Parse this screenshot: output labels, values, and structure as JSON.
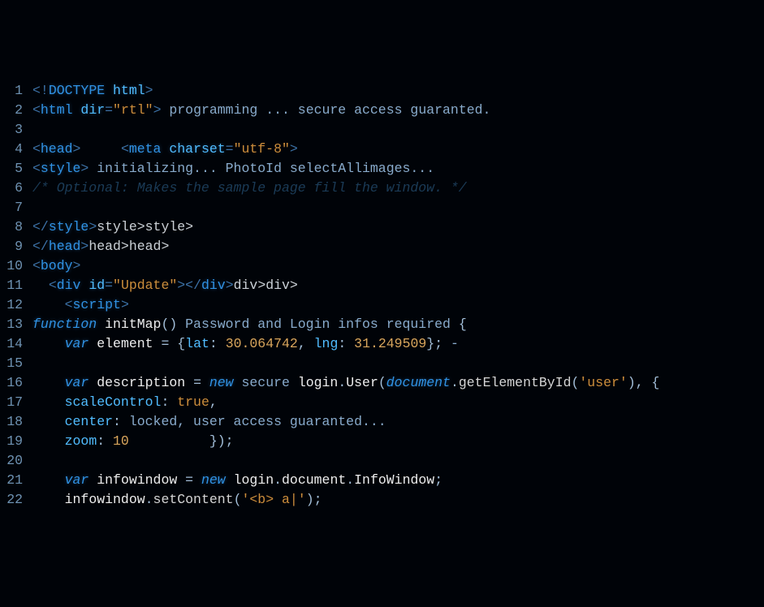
{
  "editor": {
    "lines": [
      {
        "num": "1",
        "tokens": [
          [
            "punc",
            "<"
          ],
          [
            "punc",
            "!"
          ],
          [
            "tag",
            "DOCTYPE "
          ],
          [
            "attr",
            "html"
          ],
          [
            "punc",
            ">"
          ]
        ]
      },
      {
        "num": "2",
        "tokens": [
          [
            "punc",
            "<"
          ],
          [
            "tag",
            "html "
          ],
          [
            "attr",
            "dir"
          ],
          [
            "punc",
            "="
          ],
          [
            "str",
            "\"rtl\""
          ],
          [
            "punc",
            ">"
          ],
          [
            "text",
            " programming ... secure access guaranted."
          ]
        ]
      },
      {
        "num": "3",
        "tokens": []
      },
      {
        "num": "4",
        "tokens": [
          [
            "punc",
            "<"
          ],
          [
            "tag",
            "head"
          ],
          [
            "punc",
            ">"
          ],
          [
            "text",
            "     "
          ],
          [
            "punc",
            "<"
          ],
          [
            "tag",
            "meta "
          ],
          [
            "attr",
            "charset"
          ],
          [
            "punc",
            "="
          ],
          [
            "str",
            "\"utf-8\""
          ],
          [
            "punc",
            ">"
          ]
        ]
      },
      {
        "num": "5",
        "tokens": [
          [
            "punc",
            "<"
          ],
          [
            "tag",
            "style"
          ],
          [
            "punc",
            ">"
          ],
          [
            "text",
            " initializing... PhotoId selectAllimages..."
          ]
        ]
      },
      {
        "num": "6",
        "tokens": [
          [
            "comment",
            "/* Optional: Makes the sample page fill the window. */"
          ]
        ]
      },
      {
        "num": "7",
        "tokens": []
      },
      {
        "num": "8",
        "tokens": [
          [
            "punc",
            "</"
          ],
          [
            "tag",
            "style"
          ],
          [
            "punc",
            ">"
          ],
          [
            "trail",
            "style>style>"
          ]
        ]
      },
      {
        "num": "9",
        "tokens": [
          [
            "punc",
            "</"
          ],
          [
            "tag",
            "head"
          ],
          [
            "punc",
            ">"
          ],
          [
            "trail",
            "head>head>"
          ]
        ]
      },
      {
        "num": "10",
        "tokens": [
          [
            "punc",
            "<"
          ],
          [
            "tag",
            "body"
          ],
          [
            "punc",
            ">"
          ]
        ]
      },
      {
        "num": "11",
        "tokens": [
          [
            "text",
            "  "
          ],
          [
            "punc",
            "<"
          ],
          [
            "tag",
            "div "
          ],
          [
            "attr",
            "id"
          ],
          [
            "punc",
            "="
          ],
          [
            "str",
            "\"Update\""
          ],
          [
            "punc",
            ">"
          ],
          [
            "punc",
            "</"
          ],
          [
            "tag",
            "div"
          ],
          [
            "punc",
            ">"
          ],
          [
            "trail",
            "div>div>"
          ]
        ]
      },
      {
        "num": "12",
        "tokens": [
          [
            "text",
            "    "
          ],
          [
            "punc",
            "<"
          ],
          [
            "tag",
            "script"
          ],
          [
            "punc",
            ">"
          ]
        ]
      },
      {
        "num": "13",
        "tokens": [
          [
            "kw",
            "function"
          ],
          [
            "text",
            " "
          ],
          [
            "name",
            "initMap"
          ],
          [
            "sym",
            "()"
          ],
          [
            "text",
            " Password and Login infos required "
          ],
          [
            "sym",
            "{"
          ]
        ]
      },
      {
        "num": "14",
        "tokens": [
          [
            "text",
            "    "
          ],
          [
            "kw",
            "var"
          ],
          [
            "text",
            " "
          ],
          [
            "name",
            "element"
          ],
          [
            "text",
            " "
          ],
          [
            "sym",
            "="
          ],
          [
            "text",
            " "
          ],
          [
            "sym",
            "{"
          ],
          [
            "prop",
            "lat"
          ],
          [
            "sym",
            ":"
          ],
          [
            "text",
            " "
          ],
          [
            "num",
            "30.064742"
          ],
          [
            "sym",
            ","
          ],
          [
            "text",
            " "
          ],
          [
            "prop",
            "lng"
          ],
          [
            "sym",
            ":"
          ],
          [
            "text",
            " "
          ],
          [
            "num",
            "31.249509"
          ],
          [
            "sym",
            "};"
          ],
          [
            "text",
            " -"
          ]
        ]
      },
      {
        "num": "15",
        "tokens": []
      },
      {
        "num": "16",
        "tokens": [
          [
            "text",
            "    "
          ],
          [
            "kw",
            "var"
          ],
          [
            "text",
            " "
          ],
          [
            "name",
            "description"
          ],
          [
            "text",
            " "
          ],
          [
            "sym",
            "="
          ],
          [
            "text",
            " "
          ],
          [
            "kw",
            "new"
          ],
          [
            "text",
            " secure "
          ],
          [
            "name",
            "login"
          ],
          [
            "sym",
            "."
          ],
          [
            "name",
            "User"
          ],
          [
            "sym",
            "("
          ],
          [
            "kw",
            "document"
          ],
          [
            "sym",
            "."
          ],
          [
            "call",
            "getElementById"
          ],
          [
            "sym",
            "("
          ],
          [
            "str",
            "'user'"
          ],
          [
            "sym",
            "),"
          ],
          [
            "text",
            " "
          ],
          [
            "sym",
            "{"
          ]
        ]
      },
      {
        "num": "17",
        "tokens": [
          [
            "text",
            "    "
          ],
          [
            "prop",
            "scaleControl"
          ],
          [
            "sym",
            ":"
          ],
          [
            "text",
            " "
          ],
          [
            "bool",
            "true"
          ],
          [
            "sym",
            ","
          ]
        ]
      },
      {
        "num": "18",
        "tokens": [
          [
            "text",
            "    "
          ],
          [
            "prop",
            "center"
          ],
          [
            "sym",
            ":"
          ],
          [
            "text",
            " locked, user access guaranted..."
          ]
        ]
      },
      {
        "num": "19",
        "tokens": [
          [
            "text",
            "    "
          ],
          [
            "prop",
            "zoom"
          ],
          [
            "sym",
            ":"
          ],
          [
            "text",
            " "
          ],
          [
            "num",
            "10"
          ],
          [
            "text",
            "          "
          ],
          [
            "sym",
            "});"
          ]
        ]
      },
      {
        "num": "20",
        "tokens": []
      },
      {
        "num": "21",
        "tokens": [
          [
            "text",
            "    "
          ],
          [
            "kw",
            "var"
          ],
          [
            "text",
            " "
          ],
          [
            "name",
            "infowindow"
          ],
          [
            "text",
            " "
          ],
          [
            "sym",
            "="
          ],
          [
            "text",
            " "
          ],
          [
            "kw",
            "new"
          ],
          [
            "text",
            " "
          ],
          [
            "name",
            "login"
          ],
          [
            "sym",
            "."
          ],
          [
            "name",
            "document"
          ],
          [
            "sym",
            "."
          ],
          [
            "name",
            "InfoWindow"
          ],
          [
            "sym",
            ";"
          ]
        ]
      },
      {
        "num": "22",
        "tokens": [
          [
            "text",
            "    "
          ],
          [
            "name",
            "infowindow"
          ],
          [
            "sym",
            "."
          ],
          [
            "call",
            "setContent"
          ],
          [
            "sym",
            "("
          ],
          [
            "str",
            "'<b> a|'"
          ],
          [
            "sym",
            ");"
          ]
        ]
      }
    ]
  },
  "token_classes": {
    "punc": "t-punc",
    "tag": "t-tag",
    "attr": "t-attr",
    "str": "t-str",
    "text": "t-text",
    "kw": "t-kw",
    "name": "t-name",
    "prop": "t-prop",
    "num": "t-num",
    "bool": "t-bool",
    "sym": "t-sym",
    "call": "t-call",
    "comment": "t-comment",
    "trail": "t-trail"
  }
}
